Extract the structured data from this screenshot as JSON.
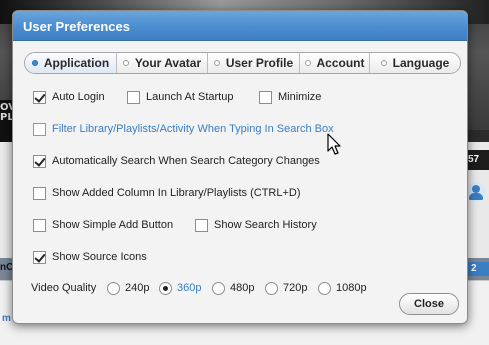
{
  "background": {
    "left_snippet": "OV\nPLI",
    "right_bar_text": "57",
    "strip_left_text": "nC",
    "strip_badge": "2",
    "bottom_left_text": "m"
  },
  "dialog": {
    "title": "User Preferences",
    "tabs": [
      {
        "label": "Application",
        "active": true
      },
      {
        "label": "Your Avatar",
        "active": false
      },
      {
        "label": "User Profile",
        "active": false
      },
      {
        "label": "Account",
        "active": false
      },
      {
        "label": "Language",
        "active": false
      }
    ],
    "options": {
      "auto_login": {
        "label": "Auto Login",
        "checked": true
      },
      "launch_at_startup": {
        "label": "Launch At Startup",
        "checked": false
      },
      "minimize": {
        "label": "Minimize",
        "checked": false
      },
      "filter_library": {
        "label": "Filter Library/Playlists/Activity When Typing In Search Box",
        "checked": false
      },
      "auto_search": {
        "label": "Automatically Search When Search Category Changes",
        "checked": true
      },
      "show_added_column": {
        "label": "Show Added Column In Library/Playlists (CTRL+D)",
        "checked": false
      },
      "show_simple_add": {
        "label": "Show Simple Add Button",
        "checked": false
      },
      "show_search_history": {
        "label": "Show Search History",
        "checked": false
      },
      "show_source_icons": {
        "label": "Show Source Icons",
        "checked": true
      }
    },
    "video_quality": {
      "label": "Video Quality",
      "options": [
        "240p",
        "360p",
        "480p",
        "720p",
        "1080p"
      ],
      "selected": "360p"
    },
    "close_label": "Close"
  },
  "colors": {
    "titlebar": "#4a8dd0",
    "accent_link": "#3a7ec4"
  }
}
